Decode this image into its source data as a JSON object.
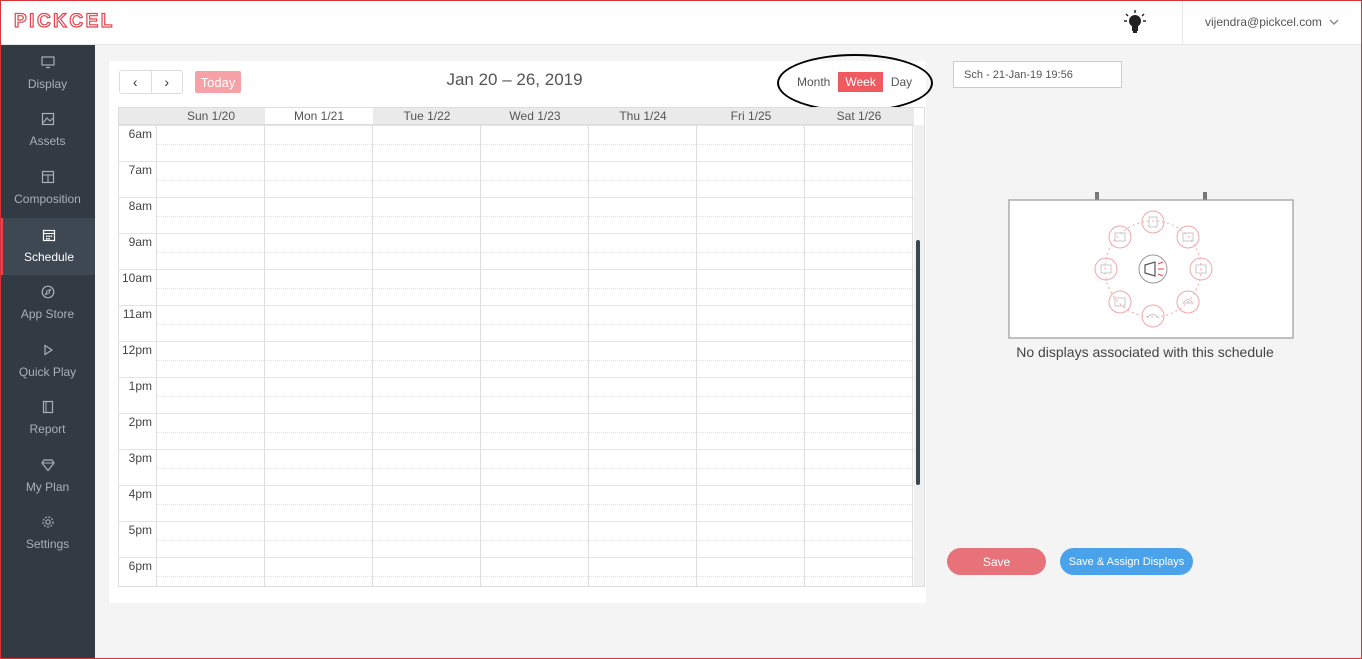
{
  "brand": {
    "logo": "PICKCEL",
    "accent": "#e8434d"
  },
  "header": {
    "user_email": "vijendra@pickcel.com"
  },
  "sidebar": {
    "items": [
      {
        "label": "Display",
        "icon": "monitor-icon"
      },
      {
        "label": "Assets",
        "icon": "image-icon"
      },
      {
        "label": "Composition",
        "icon": "layout-icon"
      },
      {
        "label": "Schedule",
        "icon": "calendar-icon",
        "active": true
      },
      {
        "label": "App Store",
        "icon": "compass-icon"
      },
      {
        "label": "Quick Play",
        "icon": "play-icon"
      },
      {
        "label": "Report",
        "icon": "report-icon"
      },
      {
        "label": "My Plan",
        "icon": "diamond-icon"
      },
      {
        "label": "Settings",
        "icon": "gear-icon"
      }
    ]
  },
  "calendar": {
    "prev": "‹",
    "next": "›",
    "today_label": "Today",
    "title": "Jan 20 – 26, 2019",
    "views": [
      "Month",
      "Week",
      "Day"
    ],
    "active_view": "Week",
    "days": [
      "Sun 1/20",
      "Mon 1/21",
      "Tue 1/22",
      "Wed 1/23",
      "Thu 1/24",
      "Fri 1/25",
      "Sat 1/26"
    ],
    "today_index": 1,
    "hours": [
      "6am",
      "7am",
      "8am",
      "9am",
      "10am",
      "11am",
      "12pm",
      "1pm",
      "2pm",
      "3pm",
      "4pm",
      "5pm",
      "6pm"
    ]
  },
  "schedule": {
    "name_value": "Sch - 21-Jan-19 19:56",
    "empty_message": "No displays associated with this schedule",
    "save_label": "Save",
    "assign_label": "Save & Assign Displays"
  }
}
